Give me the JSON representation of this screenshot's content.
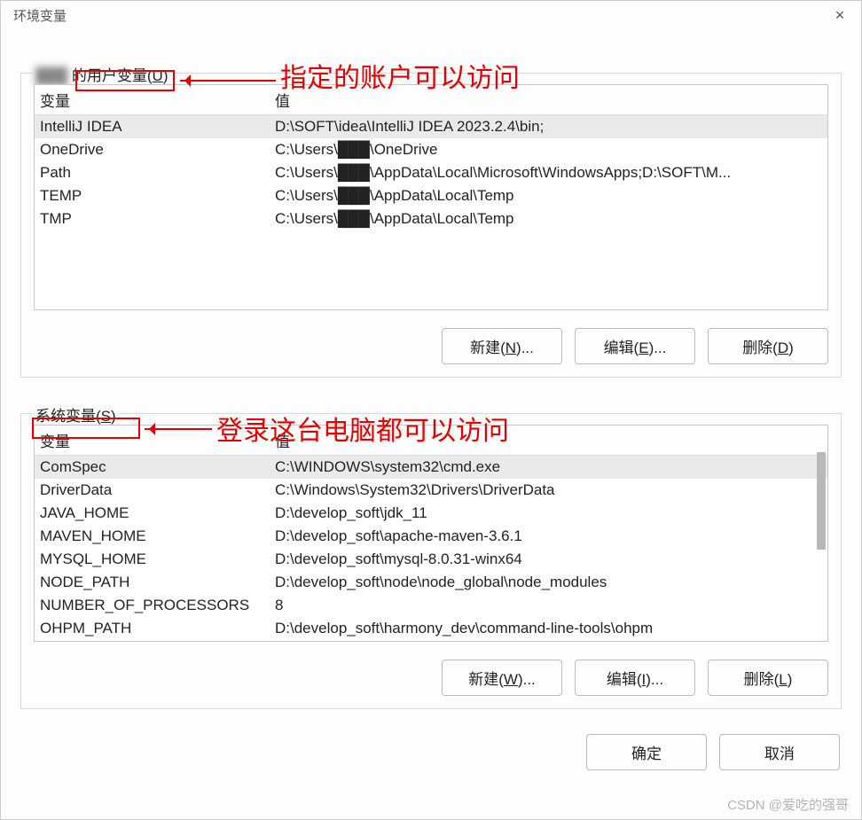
{
  "window": {
    "title": "环境变量",
    "close_icon": "×"
  },
  "annotations": {
    "user_note": "指定的账户可以访问",
    "system_note": "登录这台电脑都可以访问"
  },
  "user_vars": {
    "label_prefix": "的用户变量(",
    "label_hotkey": "U",
    "label_suffix": ")",
    "col_var": "变量",
    "col_val": "值",
    "rows": [
      {
        "var": "IntelliJ IDEA",
        "val": "D:\\SOFT\\idea\\IntelliJ IDEA 2023.2.4\\bin;"
      },
      {
        "var": "OneDrive",
        "val": "C:\\Users\\███\\OneDrive"
      },
      {
        "var": "Path",
        "val": "C:\\Users\\███\\AppData\\Local\\Microsoft\\WindowsApps;D:\\SOFT\\M..."
      },
      {
        "var": "TEMP",
        "val": "C:\\Users\\███\\AppData\\Local\\Temp"
      },
      {
        "var": "TMP",
        "val": "C:\\Users\\███\\AppData\\Local\\Temp"
      }
    ],
    "buttons": {
      "new_label": "新建(",
      "new_key": "N",
      "new_suffix": ")...",
      "edit_label": "编辑(",
      "edit_key": "E",
      "edit_suffix": ")...",
      "del_label": "删除(",
      "del_key": "D",
      "del_suffix": ")"
    }
  },
  "system_vars": {
    "label_prefix": "系统变量(",
    "label_hotkey": "S",
    "label_suffix": ")",
    "col_var": "变量",
    "col_val": "值",
    "rows": [
      {
        "var": "ComSpec",
        "val": "C:\\WINDOWS\\system32\\cmd.exe"
      },
      {
        "var": "DriverData",
        "val": "C:\\Windows\\System32\\Drivers\\DriverData"
      },
      {
        "var": "JAVA_HOME",
        "val": "D:\\develop_soft\\jdk_11"
      },
      {
        "var": "MAVEN_HOME",
        "val": "D:\\develop_soft\\apache-maven-3.6.1"
      },
      {
        "var": "MYSQL_HOME",
        "val": "D:\\develop_soft\\mysql-8.0.31-winx64"
      },
      {
        "var": "NODE_PATH",
        "val": "D:\\develop_soft\\node\\node_global\\node_modules"
      },
      {
        "var": "NUMBER_OF_PROCESSORS",
        "val": "8"
      },
      {
        "var": "OHPM_PATH",
        "val": "D:\\develop_soft\\harmony_dev\\command-line-tools\\ohpm"
      }
    ],
    "buttons": {
      "new_label": "新建(",
      "new_key": "W",
      "new_suffix": ")...",
      "edit_label": "编辑(",
      "edit_key": "I",
      "edit_suffix": ")...",
      "del_label": "删除(",
      "del_key": "L",
      "del_suffix": ")"
    }
  },
  "dialog_buttons": {
    "ok": "确定",
    "cancel": "取消"
  },
  "watermark": "CSDN @爱吃的强哥"
}
